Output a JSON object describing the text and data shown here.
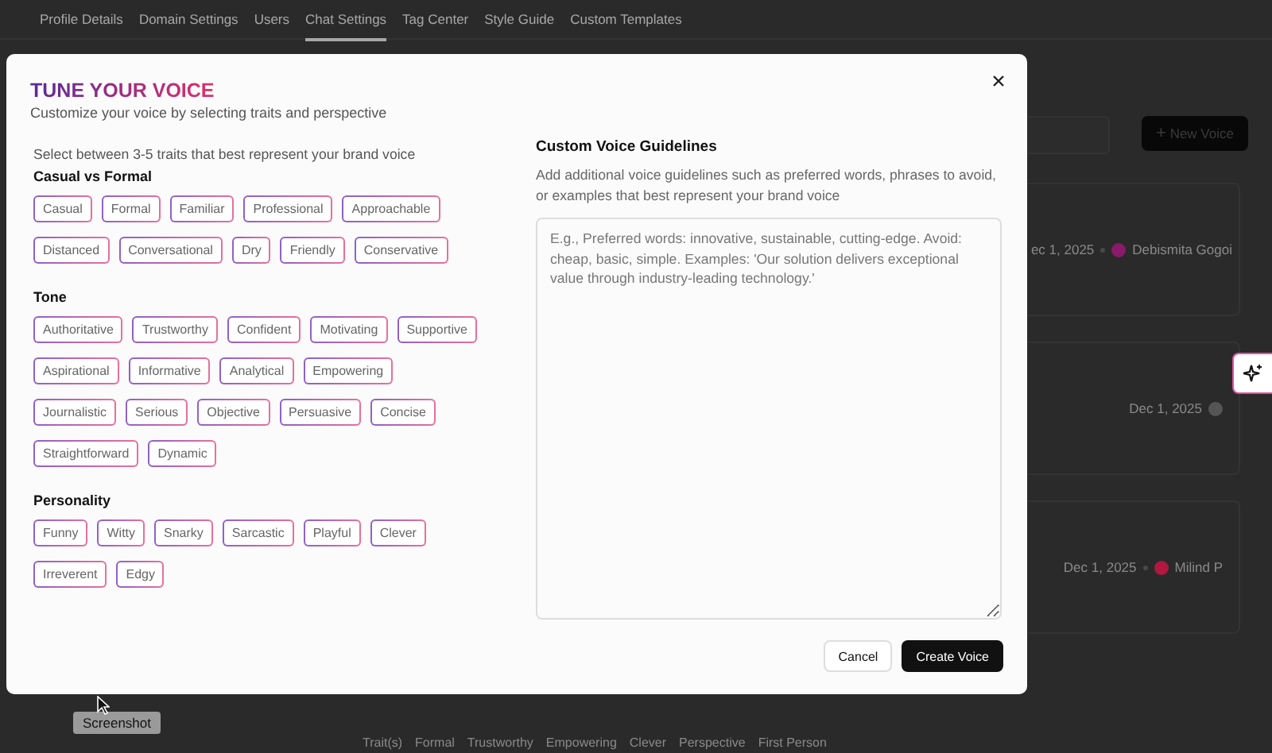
{
  "nav": {
    "tabs": [
      {
        "label": "Profile Details",
        "selected": false
      },
      {
        "label": "Domain Settings",
        "selected": false
      },
      {
        "label": "Users",
        "selected": false
      },
      {
        "label": "Chat Settings",
        "selected": true
      },
      {
        "label": "Tag Center",
        "selected": false
      },
      {
        "label": "Style Guide",
        "selected": false
      },
      {
        "label": "Custom Templates",
        "selected": false
      }
    ]
  },
  "new_voice_button": {
    "icon": "+",
    "label": "New Voice"
  },
  "voice_rows": [
    {
      "date": "ec 1, 2025",
      "author": "Debismita Gogoi",
      "color": "#8a1a6a"
    },
    {
      "date": "Dec 1, 2025",
      "author": null,
      "color": "#555555"
    },
    {
      "date": "Dec 1, 2025",
      "author": "Milind P",
      "color": "#b0183f"
    }
  ],
  "bottom_tags": [
    "Trait(s)",
    "Formal",
    "Trustworthy",
    "Empowering",
    "Clever",
    "Perspective",
    "First Person"
  ],
  "tooltip": "Screenshot",
  "modal": {
    "title": "TUNE YOUR VOICE",
    "subtitle": "Customize your voice by selecting traits and perspective",
    "instruction": "Select between 3-5 traits that best represent your brand voice",
    "groups": [
      {
        "heading": "Casual vs Formal",
        "traits": [
          {
            "label": "Casual",
            "selected": false
          },
          {
            "label": "Formal",
            "selected": false
          },
          {
            "label": "Familiar",
            "selected": false
          },
          {
            "label": "Professional",
            "selected": false
          },
          {
            "label": "Approachable",
            "selected": false
          },
          {
            "label": "Distanced",
            "selected": false
          },
          {
            "label": "Conversational",
            "selected": false
          },
          {
            "label": "Dry",
            "selected": false
          },
          {
            "label": "Friendly",
            "selected": false
          },
          {
            "label": "Conservative",
            "selected": false
          }
        ]
      },
      {
        "heading": "Tone",
        "traits": [
          {
            "label": "Authoritative",
            "selected": false
          },
          {
            "label": "Trustworthy",
            "selected": false
          },
          {
            "label": "Confident",
            "selected": false
          },
          {
            "label": "Motivating",
            "selected": false
          },
          {
            "label": "Supportive",
            "selected": false
          },
          {
            "label": "Aspirational",
            "selected": false
          },
          {
            "label": "Informative",
            "selected": false
          },
          {
            "label": "Analytical",
            "selected": false
          },
          {
            "label": "Empowering",
            "selected": false
          },
          {
            "label": "Journalistic",
            "selected": false
          },
          {
            "label": "Serious",
            "selected": false
          },
          {
            "label": "Objective",
            "selected": false
          },
          {
            "label": "Persuasive",
            "selected": false
          },
          {
            "label": "Concise",
            "selected": false
          },
          {
            "label": "Straightforward",
            "selected": false
          },
          {
            "label": "Dynamic",
            "selected": false
          }
        ]
      },
      {
        "heading": "Personality",
        "traits": [
          {
            "label": "Funny",
            "selected": false
          },
          {
            "label": "Witty",
            "selected": false
          },
          {
            "label": "Snarky",
            "selected": false
          },
          {
            "label": "Sarcastic",
            "selected": false
          },
          {
            "label": "Playful",
            "selected": false
          },
          {
            "label": "Clever",
            "selected": false
          },
          {
            "label": "Irreverent",
            "selected": false
          },
          {
            "label": "Edgy",
            "selected": false
          }
        ]
      }
    ],
    "guidelines": {
      "heading": "Custom Voice Guidelines",
      "description": "Add additional voice guidelines such as preferred words, phrases to avoid, or examples that best represent your brand voice",
      "placeholder": "E.g., Preferred words: innovative, sustainable, cutting-edge. Avoid: cheap, basic, simple. Examples: 'Our solution delivers exceptional value through industry-leading technology.'"
    },
    "buttons": {
      "cancel": "Cancel",
      "create": "Create Voice"
    }
  }
}
